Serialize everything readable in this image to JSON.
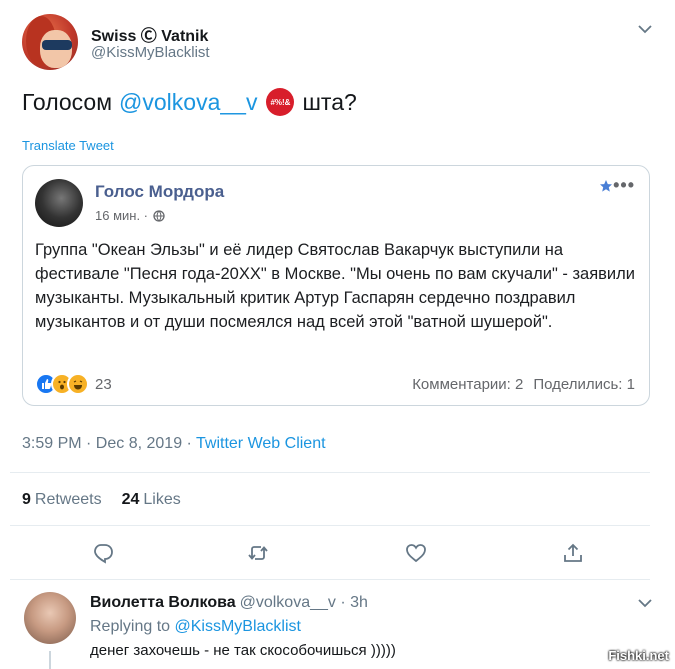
{
  "tweet": {
    "author_name": "Swiss Ⓒ Vatnik",
    "author_handle": "@KissMyBlacklist",
    "text_before": "Голосом",
    "mention": "@volkova__v",
    "emoji_glyph": "#%!&",
    "text_after": "шта?",
    "translate_label": "Translate Tweet",
    "time": "3:59 PM · Dec 8, 2019 · ",
    "client": "Twitter Web Client",
    "retweets_count": "9",
    "retweets_label": "Retweets",
    "likes_count": "24",
    "likes_label": "Likes"
  },
  "quoted_post": {
    "page_name": "Голос Мордора",
    "time_ago": "16 мин. ·",
    "dots": "•••",
    "body": "Группа \"Океан Эльзы\" и её лидер Святослав Вакарчук выступили на фестивале \"Песня года-20ХХ\" в Москве. \"Мы очень по вам скучали\" - заявили музыканты. Музыкальный критик Артур Гаспарян сердечно поздравил музыкантов и от души посмеялся над всей этой \"ватной шушерой\".",
    "reactions_count": "23",
    "comments": "Комментарии: 2",
    "shares": "Поделились: 1"
  },
  "reply": {
    "author_name": "Виолетта Волкова",
    "author_handle": "@volkova__v · 3h",
    "replying_prefix": "Replying to",
    "replying_to": "@KissMyBlacklist",
    "text": "денег захочешь - не так скособочишься )))))"
  },
  "watermark": "Fishki.net",
  "colors": {
    "link": "#1b95e0",
    "muted": "#657786",
    "fb_name": "#4a5f8f"
  }
}
